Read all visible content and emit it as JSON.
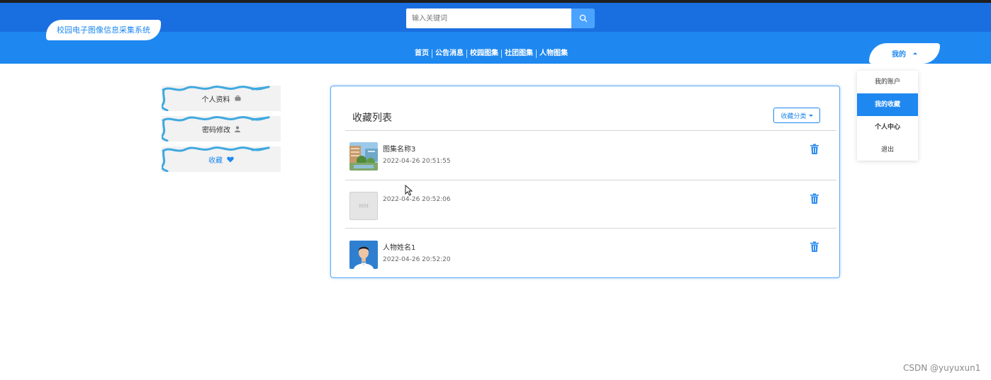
{
  "header": {
    "logo_text": "校园电子图像信息采集系统",
    "search_placeholder": "输入关键词",
    "search_icon": "search-icon",
    "nav": [
      "首页",
      "公告消息",
      "校园图集",
      "社团图集",
      "人物图集"
    ],
    "user_menu_label": "我的"
  },
  "user_dropdown": {
    "items": [
      "我的账户",
      "我的收藏",
      "个人中心",
      "退出"
    ],
    "active": "我的收藏"
  },
  "sidebar": {
    "items": [
      {
        "label": "个人资料",
        "icon": "briefcase-icon"
      },
      {
        "label": "密码修改",
        "icon": "user-icon"
      },
      {
        "label": "收藏",
        "icon": "heart-icon"
      }
    ],
    "active": "收藏"
  },
  "favorites": {
    "title": "收藏列表",
    "category_button": "收藏分类",
    "items": [
      {
        "name": "图集名称3",
        "time": "2022-04-26 20:51:55",
        "thumb": "campus-photo"
      },
      {
        "name": "",
        "time": "2022-04-26 20:52:06",
        "thumb": "MM"
      },
      {
        "name": "人物姓名1",
        "time": "2022-04-26 20:52:20",
        "thumb": "portrait-photo"
      }
    ]
  },
  "colors": {
    "primary": "#1e88f0",
    "header_dark": "#1a6fe0",
    "search_button": "#4aa3ff"
  },
  "watermark": "CSDN @yuyuxun1"
}
